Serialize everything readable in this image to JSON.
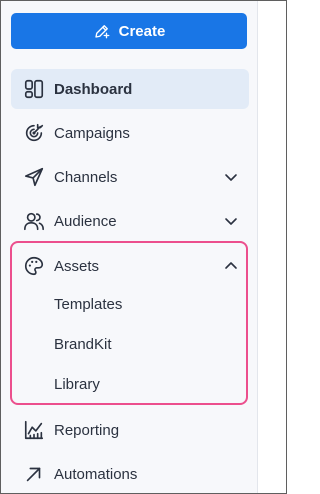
{
  "create_button": {
    "label": "Create",
    "icon": "pencil-plus-icon"
  },
  "nav": {
    "dashboard": {
      "label": "Dashboard",
      "icon": "dashboard-icon",
      "active": true
    },
    "campaigns": {
      "label": "Campaigns",
      "icon": "target-icon"
    },
    "channels": {
      "label": "Channels",
      "icon": "send-icon",
      "expanded": false
    },
    "audience": {
      "label": "Audience",
      "icon": "users-icon",
      "expanded": false
    },
    "assets": {
      "label": "Assets",
      "icon": "palette-icon",
      "expanded": true,
      "children": [
        {
          "label": "Templates"
        },
        {
          "label": "BrandKit"
        },
        {
          "label": "Library"
        }
      ]
    },
    "reporting": {
      "label": "Reporting",
      "icon": "chart-icon"
    },
    "automations": {
      "label": "Automations",
      "icon": "arrow-up-right-icon"
    }
  },
  "colors": {
    "primary": "#1976e6",
    "highlight_border": "#ec4f8d",
    "active_bg": "#e2ebf7",
    "sidebar_bg": "#f7f8fb"
  }
}
